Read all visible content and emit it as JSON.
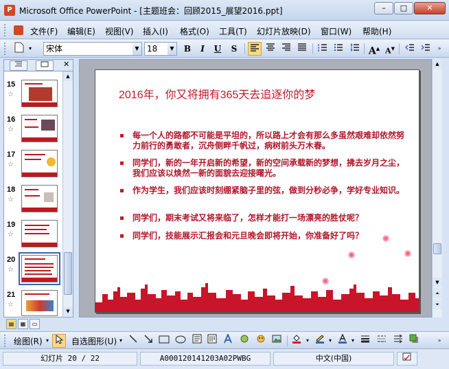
{
  "window": {
    "title": "Microsoft Office PowerPoint - [主题班会：回顾2015_展望2016.ppt]",
    "minimize": "–",
    "maximize": "□",
    "close": "✕"
  },
  "menu": [
    "文件(F)",
    "编辑(E)",
    "视图(V)",
    "插入(I)",
    "格式(O)",
    "工具(T)",
    "幻灯片放映(D)",
    "窗口(W)",
    "帮助(H)"
  ],
  "toolbar": {
    "font_name": "宋体",
    "font_size": "18",
    "bold": "B",
    "italic": "I",
    "underline": "U",
    "shadow": "S",
    "grow_font": "A",
    "shrink_font": "A"
  },
  "pane": {
    "close": "✕"
  },
  "thumbnails": [
    {
      "num": "15",
      "star": "☆"
    },
    {
      "num": "16",
      "star": "☆"
    },
    {
      "num": "17",
      "star": "☆"
    },
    {
      "num": "18",
      "star": "☆"
    },
    {
      "num": "19",
      "star": "☆"
    },
    {
      "num": "20",
      "star": "☆",
      "selected": true
    },
    {
      "num": "21",
      "star": "☆"
    }
  ],
  "slide": {
    "title": "2016年，你又将拥有365天去追逐你的梦",
    "bullets": [
      "每一个人的路都不可能是平坦的，所以路上才会有那么多虽然艰难却依然努力前行的勇敢者，沉舟侧畔千帆过，病树前头万木春。",
      "同学们，新的一年开启新的希望，新的空间承载新的梦想，拂去岁月之尘，我们应该以焕然一新的面貌去迎接曙光。",
      "作为学生，我们应该时刻绷紧脑子里的弦，做到分秒必争，学好专业知识。",
      "同学们，期末考试又将来临了，怎样才能打一场漂亮的胜仗呢？",
      "同学们，技能展示汇报会和元旦晚会即将开始，你准备好了吗？"
    ],
    "accent_color": "#c0192a"
  },
  "drawbar": {
    "draw": "绘图(R)",
    "autoshapes": "自选图形(U)"
  },
  "status": {
    "slide": "幻灯片 20 / 22",
    "design": "A000120141203A02PWBG",
    "language": "中文(中国)"
  }
}
